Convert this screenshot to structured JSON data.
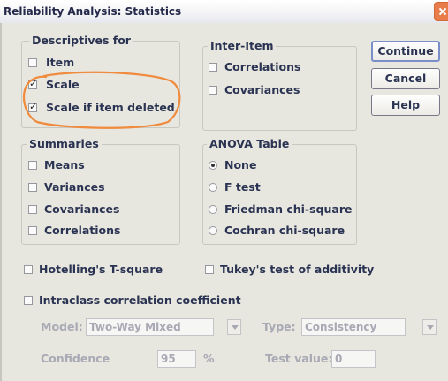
{
  "window": {
    "title": "Reliability Analysis: Statistics"
  },
  "descriptives": {
    "legend": "Descriptives for",
    "item": {
      "label": "Item",
      "checked": false
    },
    "scale": {
      "label": "Scale",
      "checked": true
    },
    "scale_if_deleted": {
      "label": "Scale if item deleted",
      "checked": true
    }
  },
  "inter_item": {
    "legend": "Inter-Item",
    "correlations": {
      "label": "Correlations",
      "checked": false
    },
    "covariances": {
      "label": "Covariances",
      "checked": false
    }
  },
  "buttons": {
    "continue": "Continue",
    "cancel": "Cancel",
    "help": "Help"
  },
  "summaries": {
    "legend": "Summaries",
    "means": "Means",
    "variances": "Variances",
    "covariances": "Covariances",
    "correlations": "Correlations"
  },
  "anova": {
    "legend": "ANOVA Table",
    "none": "None",
    "f_test": "F test",
    "friedman": "Friedman chi-square",
    "cochran": "Cochran chi-square",
    "selected": "None"
  },
  "hotelling": "Hotelling's T-square",
  "tukey": "Tukey's test of additivity",
  "intraclass": "Intraclass correlation coefficient",
  "model": {
    "label": "Model:",
    "value": "Two-Way Mixed"
  },
  "type": {
    "label": "Type:",
    "value": "Consistency"
  },
  "confidence": {
    "label": "Confidence",
    "value": "95",
    "unit": "%"
  },
  "test_value": {
    "label": "Test value:",
    "value": "0"
  },
  "annotation": {
    "color": "#f08a3c"
  }
}
